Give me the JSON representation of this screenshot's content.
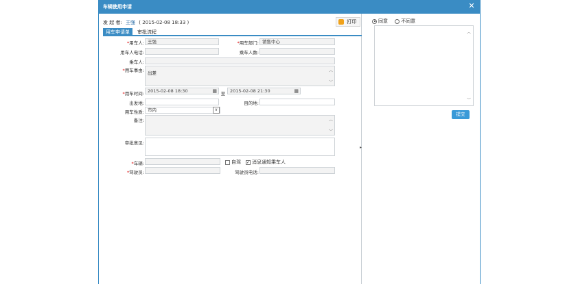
{
  "dialog": {
    "title": "车辆使用申请",
    "close_glyph": "✕"
  },
  "header": {
    "sender_label": "发 起 者:",
    "sender_name": "王强",
    "sender_time": "( 2015-02-08 18:33 )",
    "print_label": "打印"
  },
  "tabs": [
    {
      "label": "用车申请单"
    },
    {
      "label": "审批流程"
    }
  ],
  "form": {
    "user_label": "用车人:",
    "user_value": "王强",
    "dept_label": "用车部门:",
    "dept_value": "销售中心",
    "phone_label": "用车人电话:",
    "phone_value": "",
    "count_label": "乘车人数:",
    "count_value": "",
    "passenger_label": "乘车人:",
    "passenger_value": "",
    "reason_label": "用车事由:",
    "reason_value": "出差",
    "time_label": "用车时间:",
    "time_start": "2015-02-08 18:30",
    "time_to": "至",
    "time_end": "2015-02-08 21:30",
    "origin_label": "出发地:",
    "origin_value": "",
    "dest_label": "目的地:",
    "dest_value": "",
    "nature_label": "用车性质:",
    "nature_value": "市内",
    "remark_label": "备注:",
    "remark_value": "",
    "approval_label": "审批意见:",
    "approval_value": "",
    "vehicle_label": "车辆:",
    "vehicle_value": "",
    "self_drive_label": "自驾",
    "notify_label": "消息通知乘车人",
    "driver_label": "驾驶员:",
    "driver_value": "",
    "driver_phone_label": "驾驶员电话:",
    "driver_phone_value": ""
  },
  "right_panel": {
    "agree_label": "同意",
    "disagree_label": "不同意",
    "opinion_value": "",
    "submit_label": "提交"
  }
}
